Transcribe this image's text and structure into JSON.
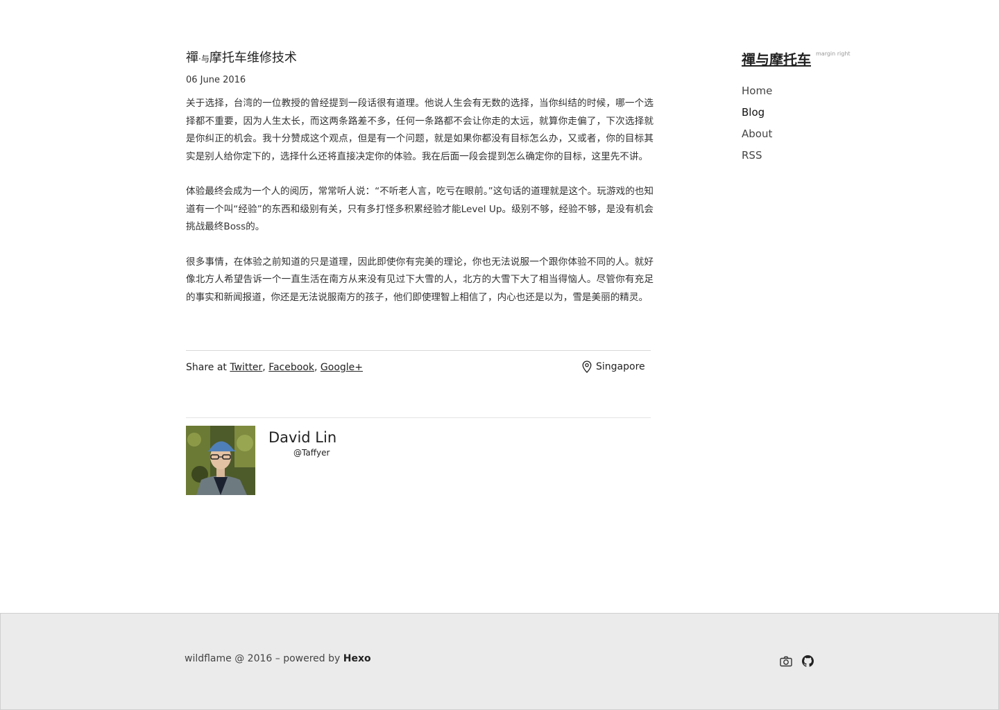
{
  "post": {
    "title_main": "禪",
    "title_dot": "·",
    "title_small": "与",
    "title_rest": "摩托车维修技术",
    "date": "06 June 2016",
    "paragraphs": [
      "关于选择，台湾的一位教授的曾经提到一段话很有道理。他说人生会有无数的选择，当你纠结的时候，哪一个选择都不重要，因为人生太长，而这两条路差不多，任何一条路都不会让你走的太远，就算你走偏了，下次选择就是你纠正的机会。我十分赞成这个观点，但是有一个问题，就是如果你都没有目标怎么办，又或者，你的目标其实是别人给你定下的，选择什么还将直接决定你的体验。我在后面一段会提到怎么确定你的目标，这里先不讲。",
      "体验最终会成为一个人的阅历，常常听人说：“不听老人言，吃亏在眼前。”这句话的道理就是这个。玩游戏的也知道有一个叫“经验”的东西和级别有关，只有多打怪多积累经验才能Level Up。级别不够，经验不够，是没有机会挑战最终Boss的。",
      "很多事情，在体验之前知道的只是道理，因此即使你有完美的理论，你也无法说服一个跟你体验不同的人。就好像北方人希望告诉一个一直生活在南方从来没有见过下大雪的人，北方的大雪下大了相当得恼人。尽管你有充足的事实和新闻报道，你还是无法说服南方的孩子，他们即使理智上相信了，内心也还是以为，雪是美丽的精灵。"
    ]
  },
  "share": {
    "prefix": "Share at",
    "twitter": "Twitter",
    "facebook": "Facebook",
    "google": "Google+",
    "sep": ","
  },
  "location": {
    "label": "Singapore",
    "icon": "map-pin-icon"
  },
  "author": {
    "name": "David Lin",
    "handle": "@Taffyer"
  },
  "sidebar": {
    "site_title": "禪与摩托车",
    "margin_note": "margin right",
    "nav": [
      "Home",
      "Blog",
      "About",
      "RSS"
    ]
  },
  "footer": {
    "text": "wildflame @ 2016 – powered by",
    "brand": "Hexo",
    "icons": [
      "camera-icon",
      "github-icon"
    ]
  },
  "colors": {
    "footer_bg": "#ebebeb",
    "text": "#222222",
    "divider": "#d8d8d8"
  }
}
